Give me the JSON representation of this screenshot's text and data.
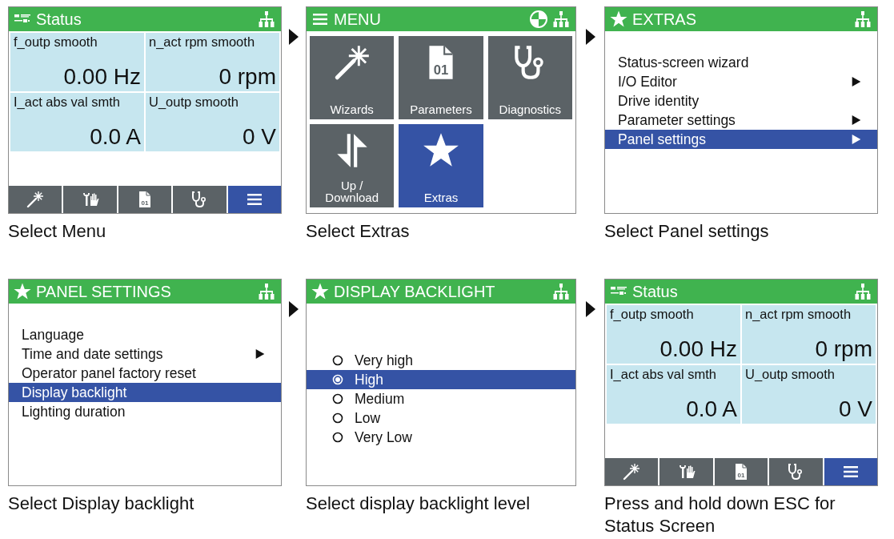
{
  "steps": [
    {
      "kind": "status",
      "title_icon": {
        "kind": "status"
      },
      "title": "Status",
      "header_icons": [
        {
          "kind": "network"
        }
      ],
      "tiles": [
        {
          "label": "f_outp smooth",
          "value": "0.00 Hz"
        },
        {
          "label": "n_act rpm smooth",
          "value": "0 rpm"
        },
        {
          "label": "I_act abs val smth",
          "value": "0.0 A"
        },
        {
          "label": "U_outp smooth",
          "value": "0 V"
        }
      ],
      "tabs": [
        {
          "kind": "wand",
          "selected": false
        },
        {
          "kind": "wrench-hand",
          "selected": false
        },
        {
          "kind": "doc",
          "icon_text": "01",
          "selected": false
        },
        {
          "kind": "stethoscope",
          "selected": false
        },
        {
          "kind": "menu",
          "selected": true
        }
      ],
      "caption": "Select Menu"
    },
    {
      "kind": "menu",
      "title_icon": {
        "kind": "menu"
      },
      "title": "MENU",
      "header_icons": [
        {
          "kind": "pie"
        },
        {
          "kind": "network"
        }
      ],
      "tiles": [
        {
          "kind": "wand",
          "label": "Wizards",
          "selected": false
        },
        {
          "kind": "doc",
          "icon_text": "01",
          "label": "Parameters",
          "selected": false
        },
        {
          "kind": "stethoscope",
          "label": "Diagnostics",
          "selected": false
        },
        {
          "kind": "updown",
          "label": "Up / Download",
          "selected": false
        },
        {
          "kind": "star",
          "label": "Extras",
          "selected": true
        }
      ],
      "caption": "Select Extras"
    },
    {
      "kind": "list",
      "title_icon": {
        "kind": "star"
      },
      "title": "EXTRAS",
      "header_icons": [
        {
          "kind": "network"
        }
      ],
      "items": [
        {
          "label": "Status-screen wizard",
          "submenu": false,
          "selected": false
        },
        {
          "label": "I/O Editor",
          "submenu": true,
          "selected": false
        },
        {
          "label": "Drive identity",
          "submenu": false,
          "selected": false
        },
        {
          "label": "Parameter settings",
          "submenu": true,
          "selected": false
        },
        {
          "label": "Panel settings",
          "submenu": true,
          "selected": true
        }
      ],
      "caption": "Select Panel settings"
    },
    {
      "kind": "list",
      "title_icon": {
        "kind": "star"
      },
      "title": "PANEL SETTINGS",
      "header_icons": [
        {
          "kind": "network"
        }
      ],
      "items": [
        {
          "label": "Language",
          "submenu": false,
          "selected": false
        },
        {
          "label": "Time and date settings",
          "submenu": true,
          "selected": false
        },
        {
          "label": "Operator panel factory reset",
          "submenu": false,
          "selected": false
        },
        {
          "label": "Display backlight",
          "submenu": false,
          "selected": true
        },
        {
          "label": "Lighting duration",
          "submenu": false,
          "selected": false
        }
      ],
      "caption": "Select Display backlight"
    },
    {
      "kind": "radio",
      "title_icon": {
        "kind": "star"
      },
      "title": "DISPLAY BACKLIGHT",
      "header_icons": [
        {
          "kind": "network"
        }
      ],
      "options": [
        {
          "label": "Very high",
          "selected": false
        },
        {
          "label": "High",
          "selected": true
        },
        {
          "label": "Medium",
          "selected": false
        },
        {
          "label": "Low",
          "selected": false
        },
        {
          "label": "Very Low",
          "selected": false
        }
      ],
      "caption": "Select display backlight level"
    },
    {
      "kind": "status",
      "title_icon": {
        "kind": "status"
      },
      "title": "Status",
      "header_icons": [
        {
          "kind": "network"
        }
      ],
      "tiles": [
        {
          "label": "f_outp smooth",
          "value": "0.00 Hz"
        },
        {
          "label": "n_act rpm smooth",
          "value": "0 rpm"
        },
        {
          "label": "I_act abs val smth",
          "value": "0.0 A"
        },
        {
          "label": "U_outp smooth",
          "value": "0 V"
        }
      ],
      "tabs": [
        {
          "kind": "wand",
          "selected": false
        },
        {
          "kind": "wrench-hand",
          "selected": false
        },
        {
          "kind": "doc",
          "icon_text": "01",
          "selected": false
        },
        {
          "kind": "stethoscope",
          "selected": false
        },
        {
          "kind": "menu",
          "selected": true
        }
      ],
      "caption": "Press and hold down ESC for Status Screen"
    }
  ]
}
